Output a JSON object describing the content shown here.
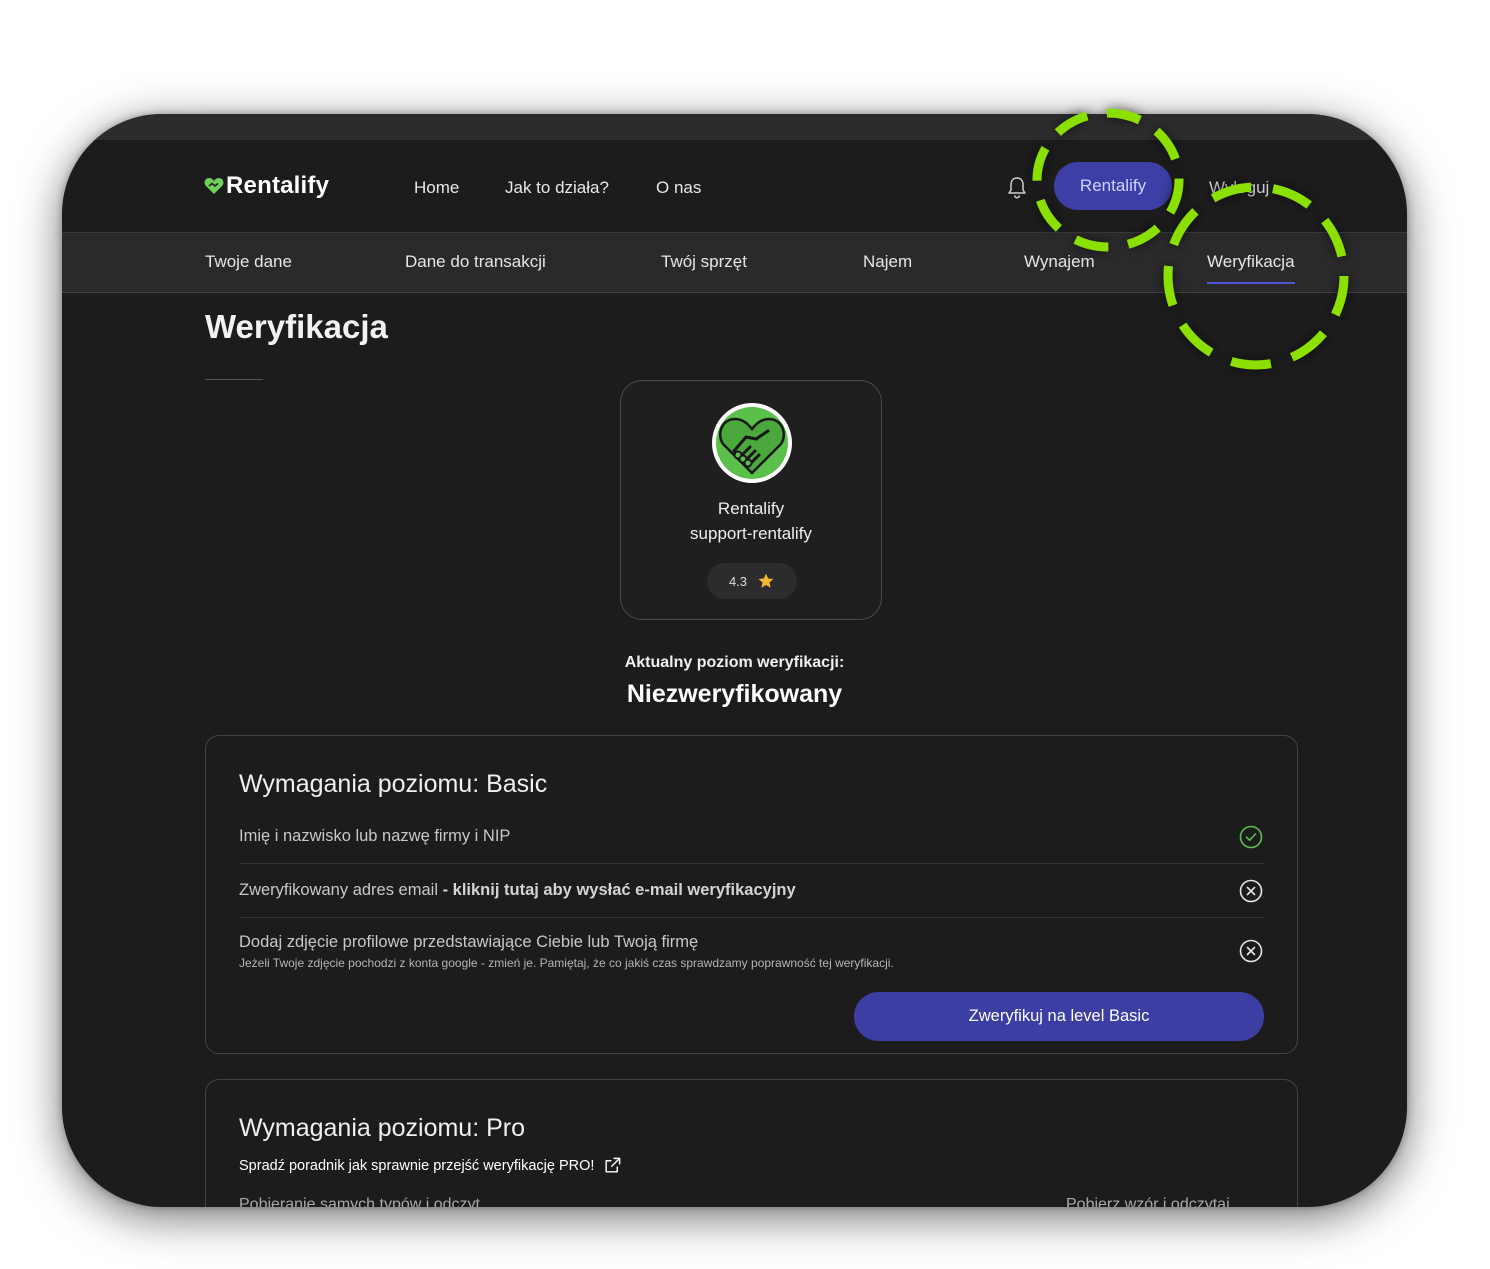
{
  "brand": {
    "name": "Rentalify",
    "accent": "#3d3fa6",
    "annotation_color": "#8be000"
  },
  "header": {
    "nav": [
      "Home",
      "Jak to działa?",
      "O nas"
    ],
    "user_button": "Rentalify",
    "logout": "Wyloguj"
  },
  "subnav": {
    "tabs": [
      "Twoje dane",
      "Dane do transakcji",
      "Twój sprzęt",
      "Najem",
      "Wynajem",
      "Weryfikacja"
    ],
    "active": "Weryfikacja"
  },
  "page": {
    "title": "Weryfikacja"
  },
  "profile": {
    "name": "Rentalify",
    "username": "support-rentalify",
    "rating": "4.3"
  },
  "verification": {
    "label": "Aktualny poziom weryfikacji:",
    "value": "Niezweryfikowany"
  },
  "basic": {
    "title": "Wymagania poziomu: Basic",
    "requirements": [
      {
        "text": "Imię i nazwisko lub nazwę firmy i NIP",
        "status": "done"
      },
      {
        "text": "Zweryfikowany adres email",
        "link": "- kliknij tutaj aby wysłać e-mail weryfikacyjny",
        "status": "missing"
      },
      {
        "text": "Dodaj zdjęcie profilowe przedstawiające Ciebie lub Twoją firmę",
        "note": "Jeżeli Twoje zdjęcie pochodzi z konta google - zmień je. Pamiętaj, że co jakiś czas sprawdzamy poprawność tej weryfikacji.",
        "status": "missing"
      }
    ],
    "button": "Zweryfikuj na level Basic"
  },
  "pro": {
    "title": "Wymagania poziomu: Pro",
    "guide_link": "Spradź poradnik jak sprawnie przejść weryfikację PRO!",
    "cut_left": "Pobieranie samych typów i odczyt...",
    "cut_right": "Pobierz wzór i odczytaj..."
  }
}
